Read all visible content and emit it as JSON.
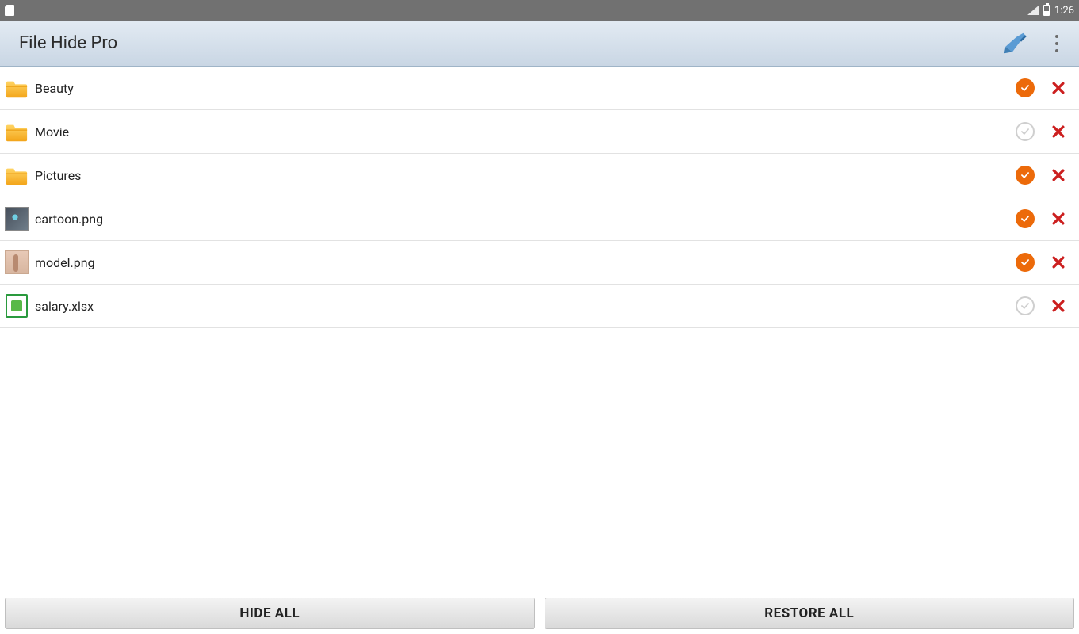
{
  "status": {
    "time": "1:26"
  },
  "appbar": {
    "title": "File Hide Pro"
  },
  "list": {
    "items": [
      {
        "name": "Beauty",
        "icon": "folder",
        "active": true
      },
      {
        "name": "Movie",
        "icon": "folder",
        "active": false
      },
      {
        "name": "Pictures",
        "icon": "folder",
        "active": true
      },
      {
        "name": "cartoon.png",
        "icon": "cartoon",
        "active": true
      },
      {
        "name": "model.png",
        "icon": "model",
        "active": true
      },
      {
        "name": "salary.xlsx",
        "icon": "xlsx",
        "active": false
      }
    ]
  },
  "bottom": {
    "hide_all": "HIDE ALL",
    "restore_all": "RESTORE ALL"
  }
}
